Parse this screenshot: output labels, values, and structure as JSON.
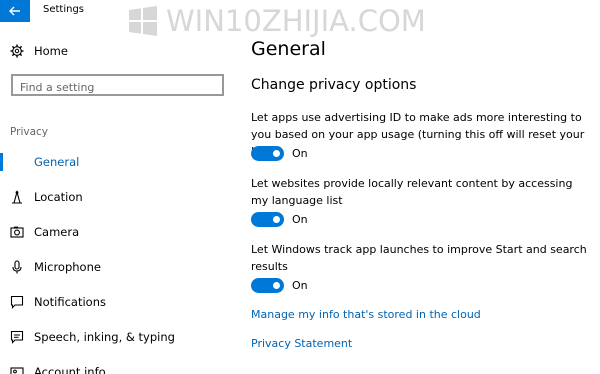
{
  "window": {
    "title": "Settings"
  },
  "watermark": {
    "text": "WIN10ZHIJIA.COM"
  },
  "sidebar": {
    "home_label": "Home",
    "search": {
      "placeholder": "Find a setting",
      "value": ""
    },
    "section_label": "Privacy",
    "items": [
      {
        "label": "General",
        "icon": "general-icon",
        "active": true
      },
      {
        "label": "Location",
        "icon": "location-icon",
        "active": false
      },
      {
        "label": "Camera",
        "icon": "camera-icon",
        "active": false
      },
      {
        "label": "Microphone",
        "icon": "microphone-icon",
        "active": false
      },
      {
        "label": "Notifications",
        "icon": "notifications-icon",
        "active": false
      },
      {
        "label": "Speech, inking, & typing",
        "icon": "speech-icon",
        "active": false
      },
      {
        "label": "Account info",
        "icon": "account-info-icon",
        "active": false
      }
    ]
  },
  "main": {
    "title": "General",
    "subheading": "Change privacy options",
    "options": [
      {
        "description": "Let apps use advertising ID to make ads more interesting to you based on your app usage (turning this off will reset your ID)",
        "state": "On",
        "enabled": true
      },
      {
        "description": "Let websites provide locally relevant content by accessing my language list",
        "state": "On",
        "enabled": true
      },
      {
        "description": "Let Windows track app launches to improve Start and search results",
        "state": "On",
        "enabled": true
      }
    ],
    "links": {
      "manage_info": "Manage my info that's stored in the cloud",
      "privacy_statement": "Privacy Statement"
    }
  },
  "colors": {
    "accent": "#0078d7",
    "link": "#0063b1",
    "watermark": "#d7d7d7"
  }
}
